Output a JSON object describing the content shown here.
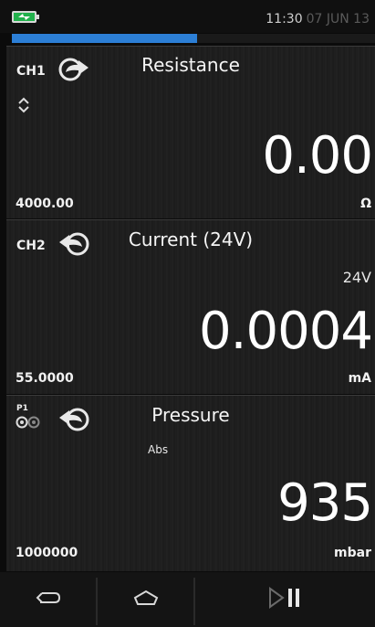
{
  "status": {
    "time": "11:30",
    "date": "07 JUN 13",
    "progress": 0.51
  },
  "channels": [
    {
      "id": "CH1",
      "title": "Resistance",
      "reading": "0.00",
      "range": "4000.00",
      "unit": "Ω",
      "direction": "output"
    },
    {
      "id": "CH2",
      "title": "Current (24V)",
      "extra": "24V",
      "reading": "0.0004",
      "range": "55.0000",
      "unit": "mA",
      "direction": "input"
    },
    {
      "id": "P1",
      "title": "Pressure",
      "extra": "Abs",
      "reading": "935",
      "range": "1000000",
      "unit": "mbar",
      "direction": "input"
    }
  ],
  "nav": {
    "buttons": [
      "back",
      "home",
      "play-pause"
    ]
  },
  "colors": {
    "accent": "#2c7fd6",
    "battery": "#22b14c"
  }
}
